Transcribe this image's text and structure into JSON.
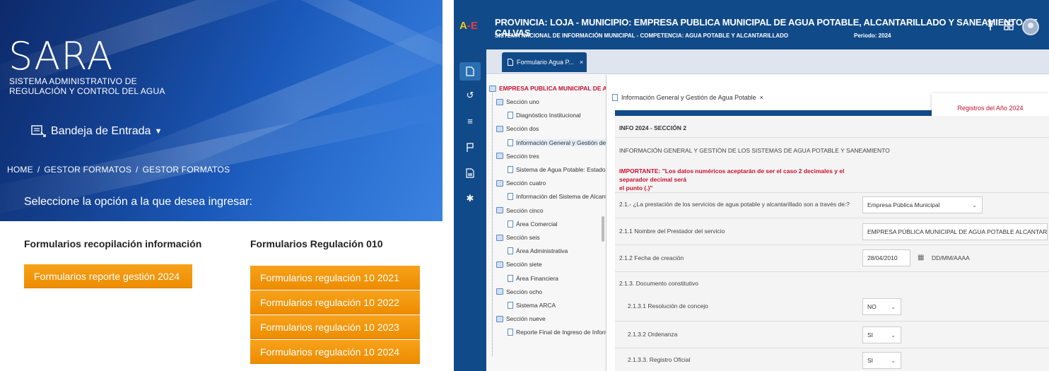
{
  "left": {
    "logo": "SARA",
    "subtitle_line1": "SISTEMA ADMINISTRATIVO DE",
    "subtitle_line2": "REGULACIÓN Y CONTROL DEL AGUA",
    "inbox_label": "Bandeja de Entrada",
    "breadcrumb": [
      "HOME",
      "GESTOR FORMATOS",
      "GESTOR FORMATOS"
    ],
    "prompt": "Seleccione la opción a la que desea ingresar:",
    "col1_title": "Formularios recopilación información",
    "col2_title": "Formularios Regulación 010",
    "col1_buttons": [
      "Formularios reporte gestión 2024"
    ],
    "col2_buttons": [
      "Formularios regulación 10 2021",
      "Formularios regulación 10 2022",
      "Formularios regulación 10 2023",
      "Formularios regulación 10 2024"
    ],
    "accent_color": "#f59a0c"
  },
  "app": {
    "logo": "A-E",
    "title": "PROVINCIA: LOJA - MUNICIPIO: EMPRESA PUBLICA MUNICIPAL DE AGUA POTABLE, ALCANTARILLADO Y SANEAMIENTO DE CALVAS",
    "subtitle": "SISTEMA NACIONAL DE INFORMACIÓN MUNICIPAL - COMPETENCIA: AGUA POTABLE Y ALCANTARILLADO",
    "period": "Periodo: 2024",
    "main_tab": "Formulario Agua P...",
    "main_tab_close": "×",
    "brand_color": "#114a88",
    "rail_icons": [
      "document-icon",
      "undo-icon",
      "list-icon",
      "flag-icon",
      "file-icon",
      "gear-icon"
    ],
    "top_icons": [
      "pin-icon",
      "grid-icon",
      "user-avatar-icon"
    ]
  },
  "tree": {
    "root": "EMPRESA PUBLICA MUNICIPAL DE AGUA",
    "items": [
      {
        "label": "Sección uno",
        "kind": "folder"
      },
      {
        "label": "Diagnóstico Institucional",
        "kind": "doc"
      },
      {
        "label": "Sección dos",
        "kind": "folder"
      },
      {
        "label": "Información General y Gestión de A",
        "kind": "doc"
      },
      {
        "label": "Sección tres",
        "kind": "folder"
      },
      {
        "label": "Sistema de Agua Potable: Estado T",
        "kind": "doc"
      },
      {
        "label": "Sección cuatro",
        "kind": "folder"
      },
      {
        "label": "Información del Sistema de Alcanta",
        "kind": "doc"
      },
      {
        "label": "Sección cinco",
        "kind": "folder"
      },
      {
        "label": "Área Comercial",
        "kind": "doc"
      },
      {
        "label": "Sección seis",
        "kind": "folder"
      },
      {
        "label": "Área Administrativa",
        "kind": "doc"
      },
      {
        "label": "Sección siete",
        "kind": "folder"
      },
      {
        "label": "Área Financiera",
        "kind": "doc"
      },
      {
        "label": "Sección ocho",
        "kind": "folder"
      },
      {
        "label": "Sistema ARCA",
        "kind": "doc"
      },
      {
        "label": "Sección nueve",
        "kind": "folder"
      },
      {
        "label": "Reporte Final de Ingreso de Inform",
        "kind": "doc"
      }
    ]
  },
  "form": {
    "tab_label": "Información General y Gestión de Agua Potable",
    "tab_close": "×",
    "records_label": "Registros del Año 2024",
    "section_header": "INFO 2024 - SECCIÓN 2",
    "section_title": "INFORMACIÓN GENERAL Y GESTIÓN DE LOS SISTEMAS DE AGUA POTABLE Y SANEAMIENTO",
    "warning_line1": "IMPORTANTE: \"Los datos numéricos aceptarán de ser el caso 2 decimales y el separador decimal será",
    "warning_line2": "el punto (.)\"",
    "q1_label": "2.1.- ¿La prestación de los servicios de agua potable y alcantarillado son a través de:?",
    "q1_value": "Empresa Pública Municipal",
    "q2_label": "2.1.1 Nombre del Prestador del servicio",
    "q2_value": "EMPRESA PÚBLICA MUNICIPAL DE AGUA POTABLE ALCANTARILLADO",
    "q3_label": "2.1.2 Fecha de creación",
    "q3_value": "28/04/2010",
    "q3_hint": "DD/MM/AAAA",
    "q4_label": "2.1.3. Documento constitutivo",
    "q5_label": "2.1.3.1 Resolución de concejo",
    "q5_value": "NO",
    "q6_label": "2.1.3.2 Ordenanza",
    "q6_value": "SI",
    "q7_label": "2.1.3.3. Registro Oficial",
    "q7_value": "SI"
  }
}
